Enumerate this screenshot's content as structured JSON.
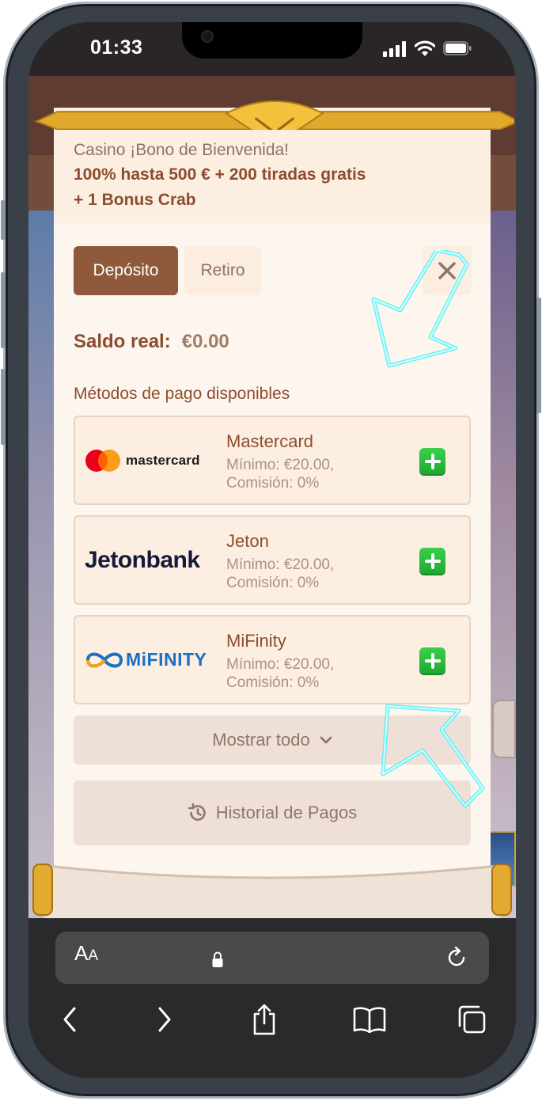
{
  "status_bar": {
    "time": "01:33"
  },
  "bonus": {
    "line1": "Casino ¡Bono de Bienvenida!",
    "line2": "100% hasta 500 € + 200 tiradas gratis",
    "line3": "+ 1 Bonus Crab"
  },
  "tabs": {
    "deposit": "Depósito",
    "withdraw": "Retiro"
  },
  "balance": {
    "label": "Saldo real:",
    "value": "€0.00"
  },
  "methods_title": "Métodos de pago disponibles",
  "methods": [
    {
      "logo": "mastercard",
      "name": "Mastercard",
      "min": "Mínimo: €20.00,",
      "fee": "Comisión: 0%"
    },
    {
      "logo": "Jetonbank",
      "name": "Jeton",
      "min": "Mínimo: €20.00,",
      "fee": "Comisión: 0%"
    },
    {
      "logo": "MiFINITY",
      "name": "MiFinity",
      "min": "Mínimo: €20.00,",
      "fee": "Comisión: 0%"
    }
  ],
  "show_all": "Mostrar todo",
  "history": "Historial de Pagos",
  "safari": {
    "text_size": "AA"
  },
  "colors": {
    "accent": "#8f5a3c",
    "add_green": "#22b436",
    "neon": "#54f0f5"
  }
}
